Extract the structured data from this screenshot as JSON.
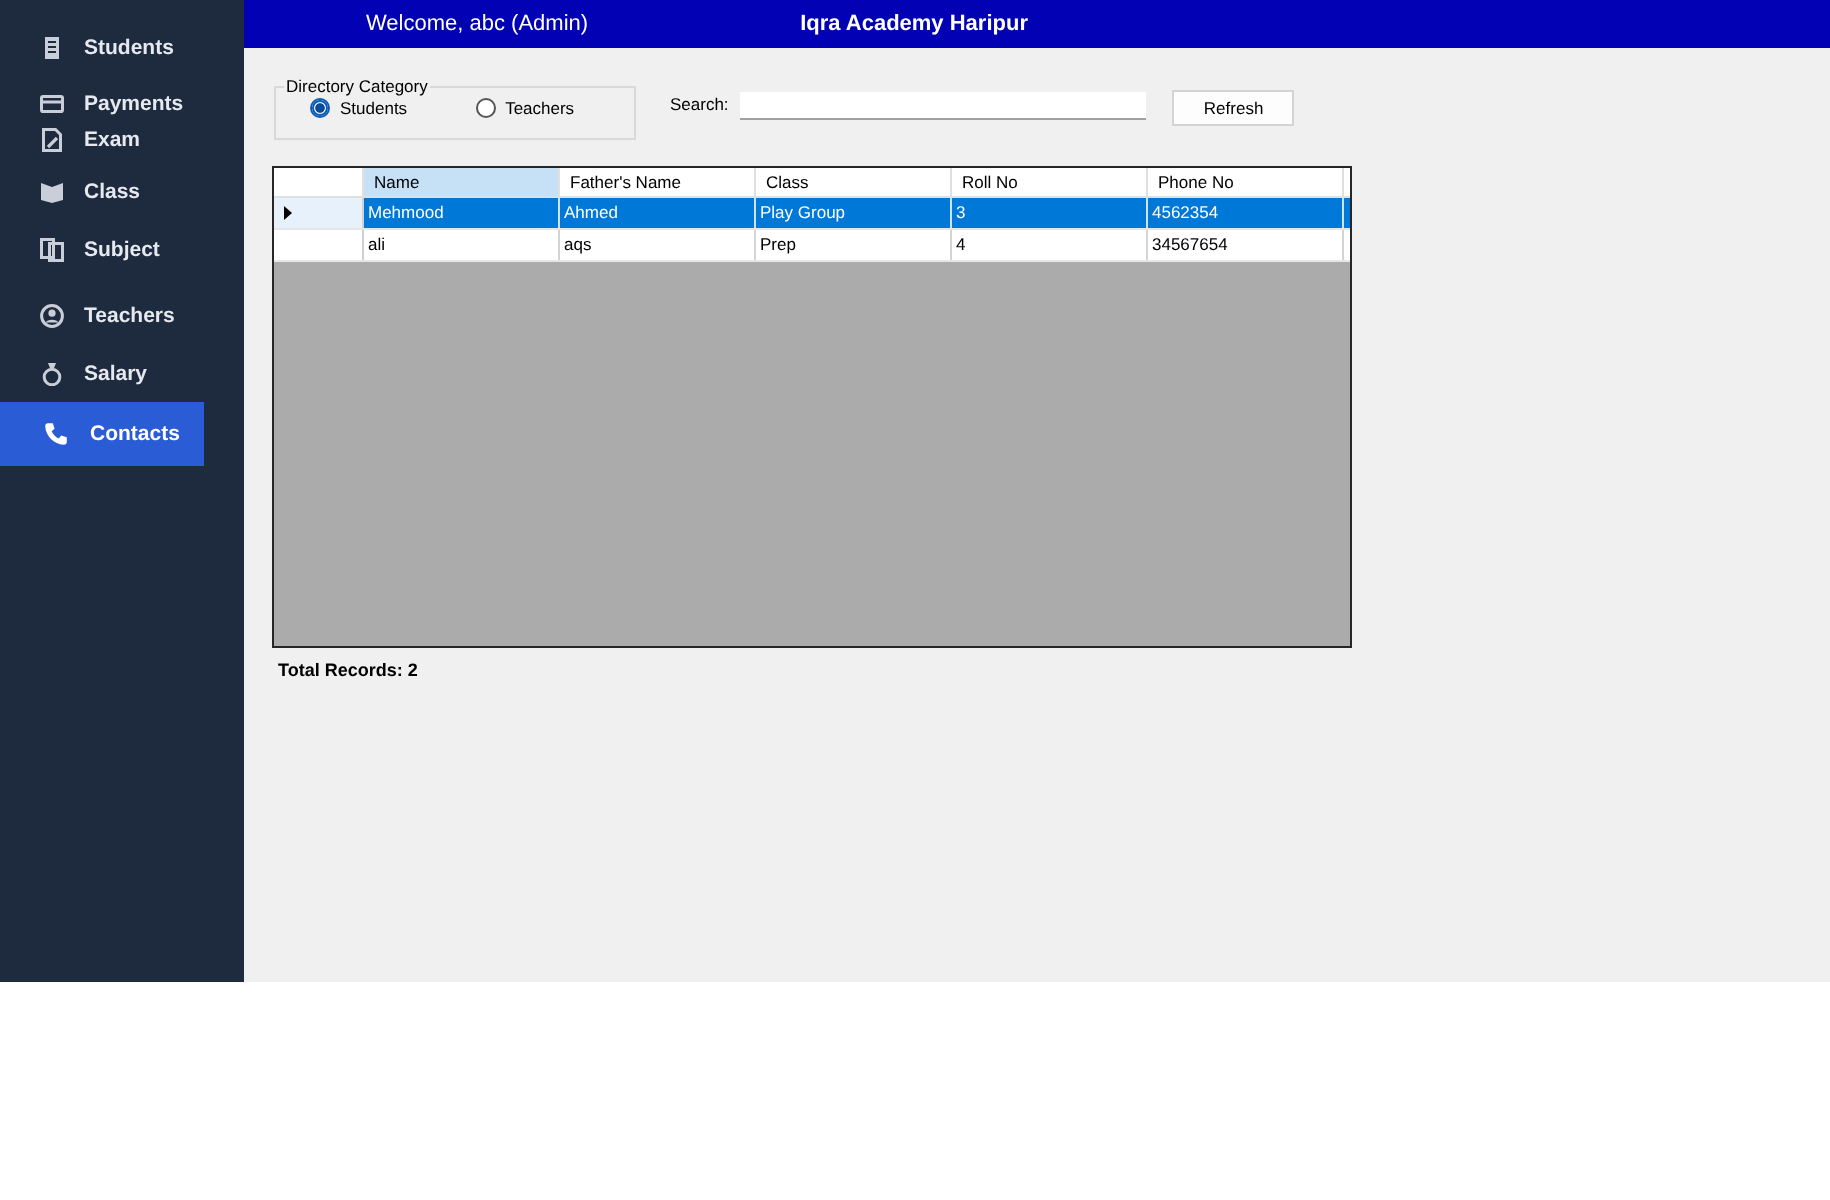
{
  "sidebar": {
    "items": [
      {
        "label": "Students",
        "selected": false
      },
      {
        "label": "Payments",
        "selected": false
      },
      {
        "label": "Exam",
        "selected": false
      },
      {
        "label": "Class",
        "selected": false
      },
      {
        "label": "Subject",
        "selected": false
      },
      {
        "label": "Teachers",
        "selected": false
      },
      {
        "label": "Salary",
        "selected": false
      },
      {
        "label": "Contacts",
        "selected": true
      }
    ]
  },
  "header": {
    "welcome": "Welcome, abc (Admin)",
    "title": "Iqra Academy Haripur"
  },
  "directory_category": {
    "title": "Directory Category",
    "options": [
      {
        "label": "Students",
        "selected": true
      },
      {
        "label": "Teachers",
        "selected": false
      }
    ]
  },
  "search": {
    "label": "Search:"
  },
  "refresh_button": {
    "label": "Refresh"
  },
  "table": {
    "columns": [
      {
        "label": "Name",
        "highlighted": true
      },
      {
        "label": "Father's Name",
        "highlighted": false
      },
      {
        "label": "Class",
        "highlighted": false
      },
      {
        "label": "Roll No",
        "highlighted": false
      },
      {
        "label": "Phone No",
        "highlighted": false
      }
    ],
    "rows": [
      {
        "selected": true,
        "current": true,
        "cells": [
          "Mehmood",
          "Ahmed",
          "Play Group",
          "3",
          "4562354"
        ]
      },
      {
        "selected": false,
        "current": false,
        "cells": [
          "ali",
          "aqs",
          "Prep",
          "4",
          "34567654"
        ]
      }
    ]
  },
  "footer": {
    "total_records": "Total Records: 2"
  }
}
